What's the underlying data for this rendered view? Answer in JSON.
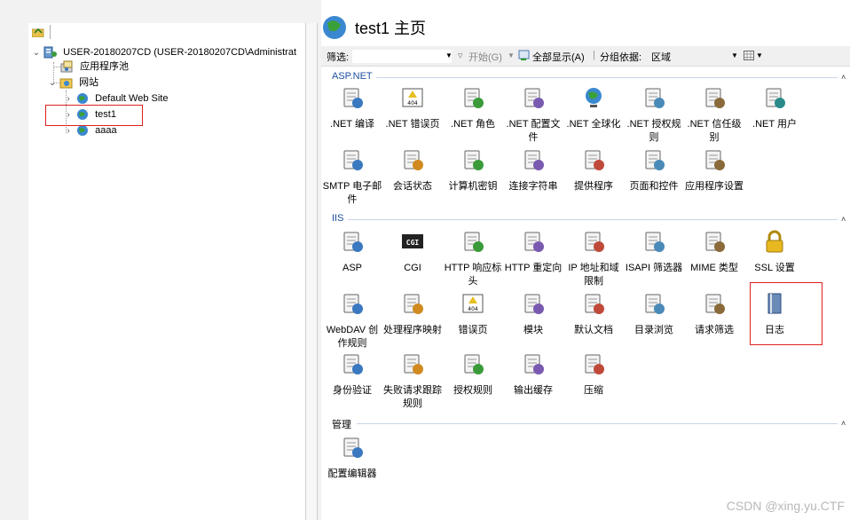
{
  "tree": {
    "server_label": "USER-20180207CD (USER-20180207CD\\Administrat",
    "app_pools_label": "应用程序池",
    "sites_label": "网站",
    "sites": [
      "Default Web Site",
      "test1",
      "aaaa"
    ]
  },
  "header": {
    "title": "test1 主页"
  },
  "filter_bar": {
    "filter_label": "筛选:",
    "start_label": "开始(G)",
    "show_all_label": "全部显示(A)",
    "group_by_label": "分组依据:",
    "group_by_value": "区域"
  },
  "sections": {
    "aspnet": {
      "title": "ASP.NET",
      "items": [
        ".NET 编译",
        ".NET 错误页",
        ".NET 角色",
        ".NET 配置文件",
        ".NET 全球化",
        ".NET 授权规则",
        ".NET 信任级别",
        ".NET 用户",
        "SMTP 电子邮件",
        "会话状态",
        "计算机密钥",
        "连接字符串",
        "提供程序",
        "页面和控件",
        "应用程序设置"
      ]
    },
    "iis": {
      "title": "IIS",
      "items": [
        "ASP",
        "CGI",
        "HTTP 响应标头",
        "HTTP 重定向",
        "IP 地址和域限制",
        "ISAPI 筛选器",
        "MIME 类型",
        "SSL 设置",
        "WebDAV 创作规则",
        "处理程序映射",
        "错误页",
        "模块",
        "默认文档",
        "目录浏览",
        "请求筛选",
        "日志",
        "身份验证",
        "失败请求跟踪规则",
        "授权规则",
        "输出缓存",
        "压缩"
      ]
    },
    "management": {
      "title": "管理",
      "items": [
        "配置编辑器"
      ]
    }
  },
  "icons": {
    "aspnet": [
      "compile-icon",
      "error-page-404-icon",
      "roles-icon",
      "profile-icon",
      "globe-icon",
      "authorization-icon",
      "trust-icon",
      "users-icon",
      "smtp-email-icon",
      "session-state-icon",
      "machine-key-icon",
      "connection-string-icon",
      "providers-icon",
      "pages-controls-icon",
      "app-settings-icon"
    ],
    "iis": [
      "asp-icon",
      "cgi-icon",
      "http-response-headers-icon",
      "http-redirect-icon",
      "ip-restrictions-icon",
      "isapi-filter-icon",
      "mime-types-icon",
      "ssl-lock-icon",
      "webdav-icon",
      "handler-mappings-icon",
      "error-pages-icon",
      "modules-icon",
      "default-document-icon",
      "directory-browsing-icon",
      "request-filtering-icon",
      "logging-icon",
      "authentication-icon",
      "failed-request-tracing-icon",
      "authorization-rules-icon",
      "output-caching-icon",
      "compression-icon"
    ],
    "management": [
      "configuration-editor-icon"
    ]
  },
  "watermark": "CSDN @xing.yu.CTF",
  "colors": {
    "section_title": "#1f4fa0",
    "highlight": "#e02020",
    "watermark": "#b8b8b8"
  }
}
